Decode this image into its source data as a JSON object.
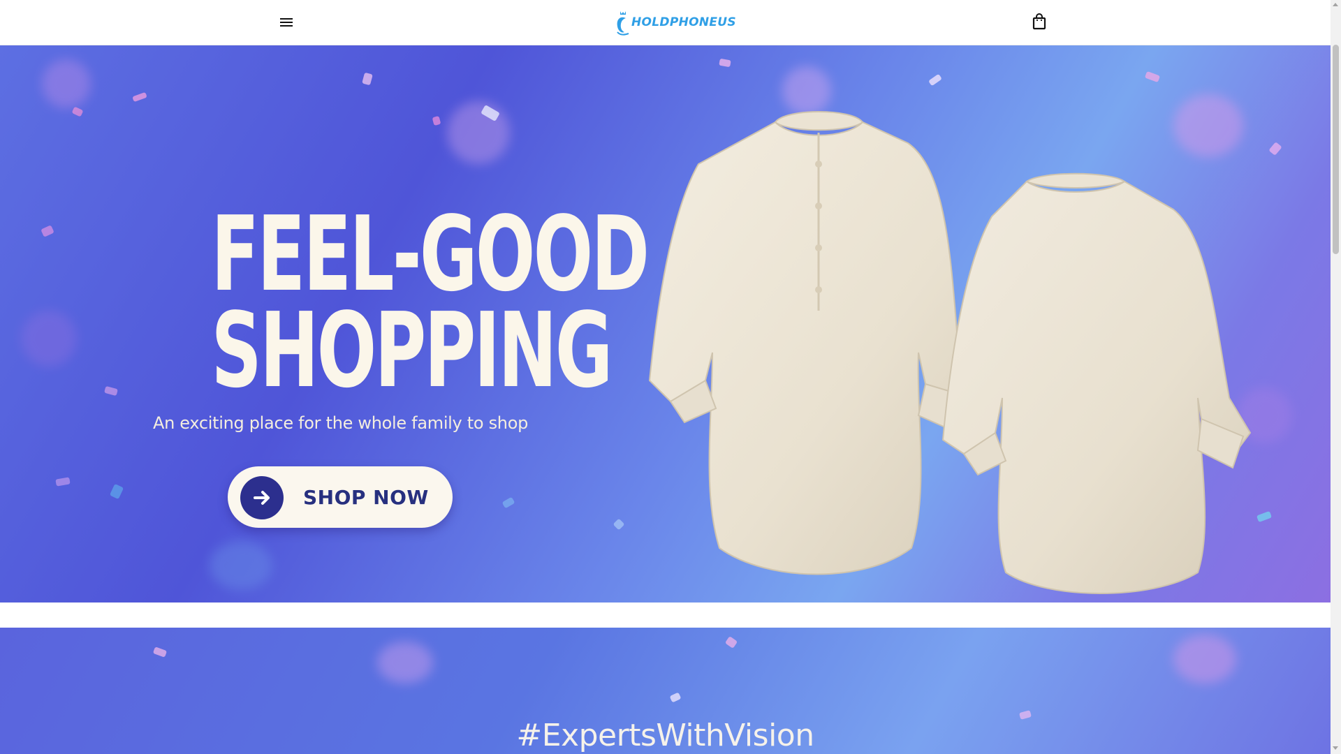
{
  "header": {
    "menu_icon": "hamburger-menu-icon",
    "logo_text": "HOLDPHONEUS",
    "cart_icon": "shopping-bag-icon"
  },
  "hero": {
    "headline_line1": "FEEL-GOOD",
    "headline_line2": "SHOPPING",
    "tagline": "An exciting place for the whole family to shop",
    "cta_label": "SHOP NOW",
    "cta_icon": "arrow-right-icon"
  },
  "second_banner": {
    "hashtag": "#ExpertsWithVision"
  },
  "colors": {
    "brand": "#2f9fe6",
    "hero_blue": "#4f55d8",
    "cta_text": "#27307f",
    "cream": "#fbf6ea"
  }
}
